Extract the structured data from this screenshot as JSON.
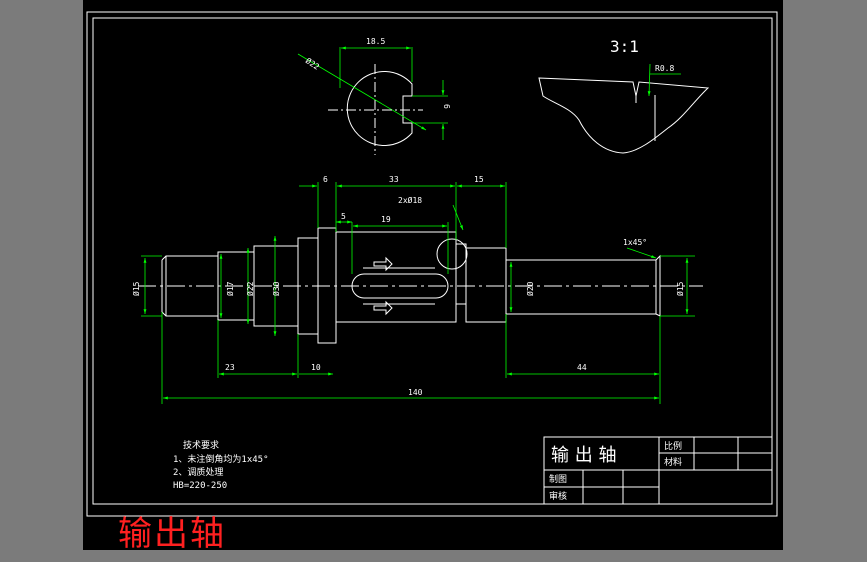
{
  "colors": {
    "background": "#000000",
    "geometry": "#ffffff",
    "dimension": "#00ff00",
    "center_line": "#ffffff",
    "caption": "#ff2020",
    "outer_frame": "#7b7b7b"
  },
  "section_view": {
    "dim_width": "18.5",
    "dim_diameter": "Ø22",
    "dim_depth": "6"
  },
  "detail_view": {
    "scale": "3:1",
    "radius": "R0.8"
  },
  "main_view": {
    "top_dims": {
      "d1": "6",
      "d2": "33",
      "d3": "15",
      "d4": "5",
      "d5": "19",
      "d6": "2xØ18"
    },
    "dia_labels": {
      "left_end": "Ø15",
      "d17": "Ø17",
      "d22": "Ø22",
      "d30": "Ø30",
      "right_mid": "Ø20",
      "right_end": "Ø15"
    },
    "bottom_dims": {
      "b1": "23",
      "b2": "10",
      "b3": "44",
      "total": "140"
    },
    "chamfer": "1x45°"
  },
  "tech_req": {
    "title": "技术要求",
    "line1": "1、未注倒角均为1x45°",
    "line2": "2、调质处理",
    "line3": "HB=220-250"
  },
  "title_block": {
    "name": "输 出 轴",
    "scale_label": "比例",
    "material_label": "材料",
    "drawn_label": "制图",
    "checked_label": "审核"
  },
  "caption": "输出轴"
}
